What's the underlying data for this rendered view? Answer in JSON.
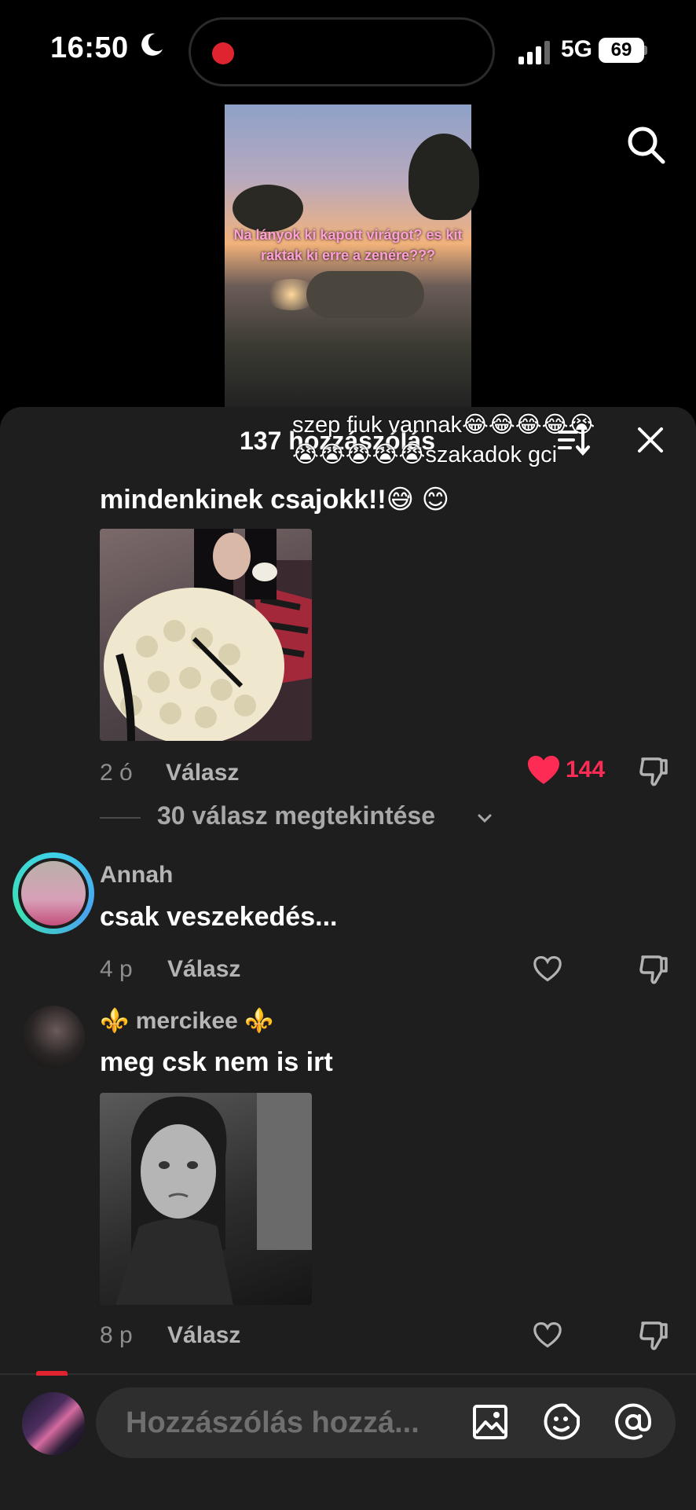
{
  "status_bar": {
    "time": "16:50",
    "network": "5G",
    "battery": "69"
  },
  "video": {
    "caption": "Na lányok ki kapott virágot? es kit raktak ki erre a zenére???"
  },
  "sheet": {
    "comment_count": "137 hozzászólás",
    "overlay_text": "szep fiuk vannak😂😂😂😂😭😭😭😭😭😭szakadok gci"
  },
  "comments": [
    {
      "text": "mindenkinek csajokk!!😅 😊",
      "time": "2 ó",
      "reply_label": "Válasz",
      "likes": "144",
      "liked": true,
      "view_replies": "30 válasz megtekintése"
    },
    {
      "username": "Annah",
      "text": "csak veszekedés...",
      "time": "4 p",
      "reply_label": "Válasz"
    },
    {
      "username": "⚜️ mercikee ⚜️",
      "text": "meg csk nem is irt",
      "time": "8 p",
      "reply_label": "Válasz"
    }
  ],
  "composer": {
    "placeholder": "Hozzászólás hozzá..."
  },
  "colors": {
    "like_red": "#fe2c55",
    "sheet_bg": "#1e1e1e",
    "story_ring": "#3fd1e8"
  },
  "icons": [
    "moon-icon",
    "signal-icon",
    "search-icon",
    "sort-icon",
    "close-icon",
    "heart-icon",
    "dislike-icon",
    "chevron-down-icon",
    "image-icon",
    "emoji-icon",
    "at-icon"
  ]
}
